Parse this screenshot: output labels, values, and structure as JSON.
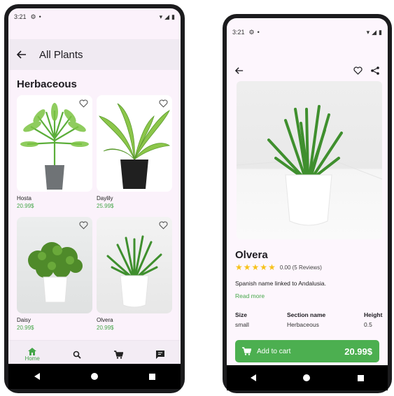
{
  "status_bar": {
    "time": "3:21"
  },
  "list_screen": {
    "title": "All Plants",
    "section": "Herbaceous",
    "products": [
      {
        "name": "Hosta",
        "price": "20.99$",
        "icon": "heart-outline-icon"
      },
      {
        "name": "Daylily",
        "price": "25.99$",
        "icon": "heart-outline-icon"
      },
      {
        "name": "Daisy",
        "price": "20.99$",
        "icon": "heart-outline-icon"
      },
      {
        "name": "Olvera",
        "price": "20.99$",
        "icon": "heart-outline-icon"
      }
    ],
    "bottom_nav": [
      {
        "label": "Home",
        "icon": "home-icon",
        "active": true
      },
      {
        "label": "",
        "icon": "search-icon"
      },
      {
        "label": "",
        "icon": "cart-icon"
      },
      {
        "label": "",
        "icon": "chat-icon"
      }
    ]
  },
  "detail_screen": {
    "name": "Olvera",
    "rating_text": "0.00 (5 Reviews)",
    "stars": 5,
    "description": "Spanish name linked to Andalusia.",
    "read_more": "Read more",
    "specs": [
      {
        "label": "Size",
        "value": "small"
      },
      {
        "label": "Section name",
        "value": "Herbaceous"
      },
      {
        "label": "Height",
        "value": "0.5"
      }
    ],
    "cart_label": "Add to cart",
    "price": "20.99$"
  },
  "colors": {
    "accent": "#45a649",
    "button": "#4caf50",
    "star": "#f7c21b",
    "background": "#fbf2fb"
  }
}
